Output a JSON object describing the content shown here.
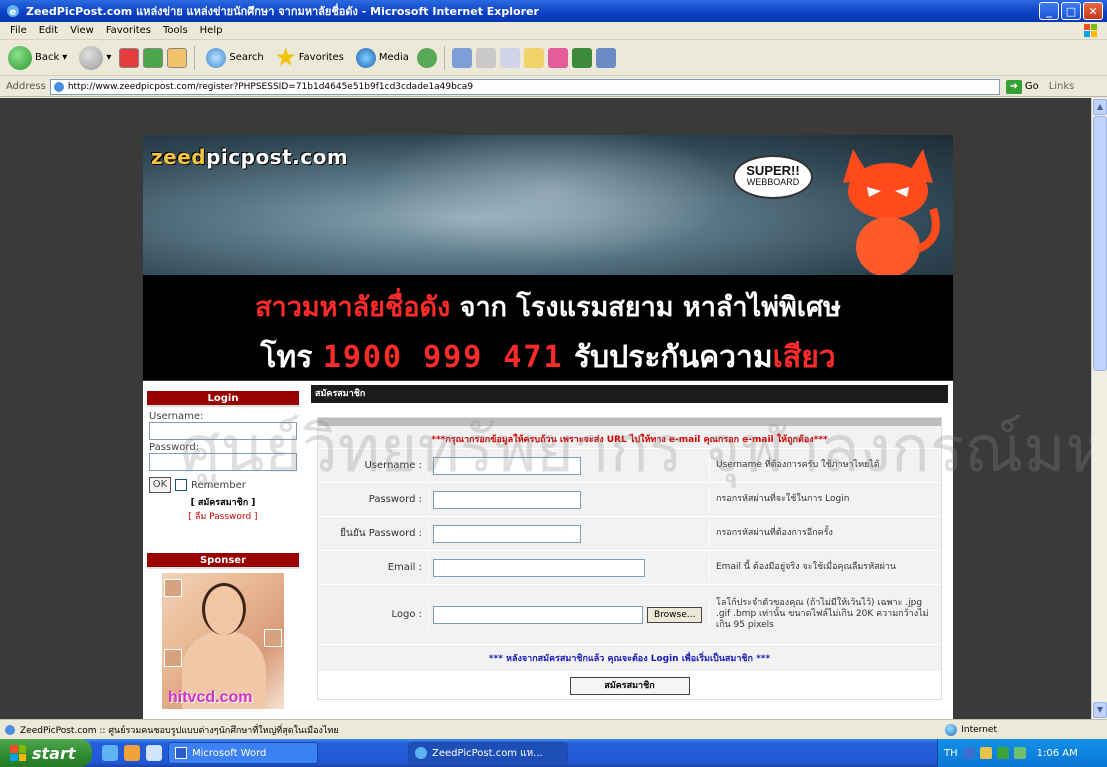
{
  "window": {
    "title": "ZeedPicPost.com แหล่งข่าย แหล่งข่ายนักศึกษา จากมหาลัยชื่อดัง - Microsoft Internet Explorer",
    "minimize": "_",
    "maximize": "□",
    "close": "✕"
  },
  "menu": [
    "File",
    "Edit",
    "View",
    "Favorites",
    "Tools",
    "Help"
  ],
  "toolbar": {
    "back_label": "Back",
    "search_label": "Search",
    "favorites_label": "Favorites",
    "media_label": "Media"
  },
  "address": {
    "label": "Address",
    "url": "http://www.zeedpicpost.com/register?PHPSESSID=71b1d4645e51b9f1cd3cdade1a49bca9",
    "go_label": "Go",
    "links_label": "Links"
  },
  "banner": {
    "logo_main": "zeed",
    "logo_rest": "picpost.com",
    "super": "SUPER!!",
    "webboard": "WEBBOARD",
    "line1_red": "สาวมหาลัยชื่อดัง",
    "line1_white": " จาก โรงแรมสยาม หาลำไพ่พิเศษ",
    "line2_white1": "โทร ",
    "line2_num": "1900 999 471",
    "line2_white2": " รับประกันความ",
    "line2_red": "เสียว"
  },
  "login": {
    "heading": "Login",
    "username_label": "Username:",
    "password_label": "Password:",
    "ok_label": "OK",
    "remember_label": "Remember",
    "register_link": "[ สมัครสมาชิก ]",
    "forgot_link": "[ ลืม Password ]"
  },
  "sponser": {
    "heading": "Sponser",
    "caption": "hitvcd.com"
  },
  "register": {
    "heading": "สมัครสมาชิก",
    "notice": "***กรุณากรอกข้อมูลให้ครบถ้วน เพราะจะส่ง URL ไปให้ทาง e-mail คุณกรอก e-mail ให้ถูกต้อง***",
    "rows": [
      {
        "label": "Username :",
        "help": "Username ที่ต้องการครับ ใช้ภาษาไทยได้"
      },
      {
        "label": "Password :",
        "help": "กรอกรหัสผ่านที่จะใช้ในการ Login"
      },
      {
        "label": "ยืนยัน Password :",
        "help": "กรอกรหัสผ่านที่ต้องการอีกครั้ง"
      },
      {
        "label": "Email :",
        "help": "Email นี้ ต้องมีอยู่จริง จะใช้เมื่อคุณลืมรหัสผ่าน"
      },
      {
        "label": "Logo :",
        "help": "โลโก้ประจำตัวของคุณ (ถ้าไม่มีให้เว้นไว้) เฉพาะ .jpg .gif .bmp เท่านั้น ขนาดไฟล์ไม่เกิน 20K ความกว้างไม่เกิน 95 pixels"
      }
    ],
    "browse_label": "Browse...",
    "after_note": "*** หลังจากสมัครสมาชิกแล้ว คุณจะต้อง Login เพื่อเริ่มเป็นสมาชิก ***",
    "submit_label": "สมัครสมาชิก"
  },
  "watermark": "ศูนย์วิทยทรัพยากร จุฬาลงกรณ์มหาวิทยาลัย",
  "status": {
    "text": "ZeedPicPost.com :: ศูนย์รวมคนชอบรูปแบบต่างๆนักศึกษาที่ใหญ่ที่สุดในเมืองไทย",
    "zone": "Internet"
  },
  "taskbar": {
    "start": "start",
    "tasks": [
      "Microsoft Word",
      "ZeedPicPost.com แห..."
    ],
    "lang": "TH",
    "clock": "1:06 AM"
  }
}
